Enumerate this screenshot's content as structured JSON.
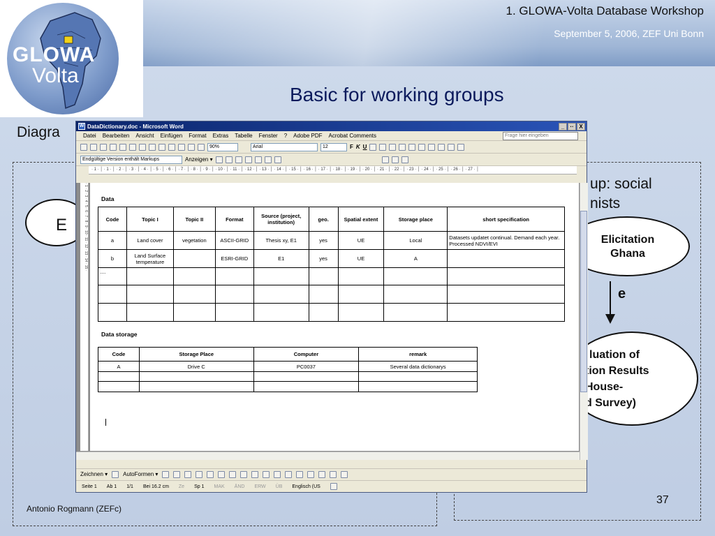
{
  "slide": {
    "workshop_title": "1. GLOWA-Volta Database Workshop",
    "date_line": "September 5, 2006, ZEF Uni Bonn",
    "title": "Basic for working groups",
    "left_heading_partial": "Diagra",
    "right_text_line1": "up: social",
    "right_text_line2": "nists",
    "left_ellipse_letter": "E",
    "elicitation_line1": "Elicitation",
    "elicitation_line2": "Ghana",
    "arrow_label": "e",
    "eval_line1": "luation of",
    "eval_line2": "tion Results",
    "eval_line3": "House-",
    "eval_line4": "d Survey)",
    "author": "Antonio Rogmann (ZEFc)",
    "page_number": "37"
  },
  "logo": {
    "line1": "GLOWA",
    "line2": "Volta"
  },
  "word": {
    "window_title": "DataDictionary.doc - Microsoft Word",
    "title_controls": [
      "_",
      "··",
      "X"
    ],
    "menu": [
      "Datei",
      "Bearbeiten",
      "Ansicht",
      "Einfügen",
      "Format",
      "Extras",
      "Tabelle",
      "Fenster",
      "?",
      "Adobe PDF",
      "Acrobat Comments"
    ],
    "help_placeholder": "Frage hier eingeben",
    "zoom": "90%",
    "font_name": "Arial",
    "font_size": "12",
    "bold_label": "F",
    "italic_label": "K",
    "underline_label": "U",
    "markup_mode": "Endgültige Version enthält Markups",
    "anzeigen_label": "Anzeigen ▾",
    "ruler_text": "· 1 · │ · 1 · │ · 2 · │ · 3 · │ · 4 · │ · 5 · │ · 6 · │ · 7 · │ · 8 · │ · 9 · │ · 10 · │ · 11 · │ · 12 · │ · 13 · │ · 14 · │ · 15 · │ · 16 · │ · 17 · │ · 18 · │ · 19 · │ · 20 · │ · 21 · │ · 22 · │ · 23 · │ · 24 · │ · 25 · │ · 26 · │ · 27 · │",
    "vruler_text": "· 1 · 2 · 3 · 4 · 5 · 6 · 7 · 8 · 9 · 10 · 11 · 12 · 13 · 14 · 15 ·",
    "data_section": "Data",
    "data_table": {
      "headers": [
        "Code",
        "Topic I",
        "Topic II",
        "Format",
        "Source (project, institution)",
        "geo.",
        "Spatial extent",
        "Storage place",
        "short specification"
      ],
      "rows": [
        [
          "a",
          "Land cover",
          "vegetation",
          "ASCII-GRID",
          "Thesis xy, E1",
          "yes",
          "UE",
          "Local",
          "Datasets updatet continual. Demand each year. Processed NDVI/EVI"
        ],
        [
          "b",
          "Land Surface temperature",
          "",
          "ESRI-GRID",
          "E1",
          "yes",
          "UE",
          "A",
          ""
        ],
        [
          "....",
          "",
          "",
          "",
          "",
          "",
          "",
          "",
          ""
        ],
        [
          "",
          "",
          "",
          "",
          "",
          "",
          "",
          "",
          ""
        ],
        [
          "",
          "",
          "",
          "",
          "",
          "",
          "",
          "",
          ""
        ]
      ]
    },
    "storage_section": "Data storage",
    "storage_table": {
      "headers": [
        "Code",
        "Storage Place",
        "Computer",
        "remark"
      ],
      "rows": [
        [
          "A",
          "Drive C",
          "PC0037",
          "Several data dictionarys"
        ],
        [
          "",
          "",
          "",
          ""
        ],
        [
          "",
          "",
          "",
          ""
        ]
      ]
    },
    "draw_toolbar": {
      "zeichnen": "Zeichnen ▾",
      "autoformen": "AutoFormen ▾"
    },
    "status": {
      "seite": "Seite  1",
      "ab": "Ab  1",
      "pages": "1/1",
      "bei": "Bei  16.2 cm",
      "ze": "Ze",
      "sp": "Sp  1",
      "mak": "MAK",
      "and": "ÄND",
      "erw": "ERW",
      "ub": "ÜB",
      "language": "Englisch (US"
    }
  }
}
